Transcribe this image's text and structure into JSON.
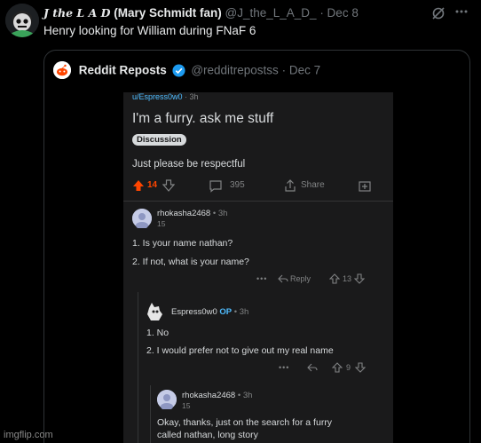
{
  "tweet": {
    "author_name_styled": "J the L A D",
    "author_name_suffix": "(Mary Schmidt fan)",
    "handle": "@J_the_L_A_D_",
    "date": "· Dec 8",
    "text": "Henry looking for William during FNaF 6",
    "icons": [
      "grok-icon",
      "more-icon"
    ]
  },
  "quote": {
    "author": "Reddit Reposts",
    "handle": "@redditrepostss",
    "date": "· Dec 7",
    "verified_color": "#1d9bf0"
  },
  "reddit_post": {
    "meta_user": "u/Espress0w0",
    "meta_time": "· 3h",
    "title": "I'm a furry. ask me stuff",
    "flair": "Discussion",
    "body": "Just please be respectful",
    "votes": "14",
    "comments": "395",
    "share_label": "Share",
    "upvote_color": "#ff4500"
  },
  "comments": [
    {
      "user": "rhokasha2468",
      "time": "• 3h",
      "sub": "15",
      "lines": [
        "1. Is your name nathan?",
        "2. If not, what is your name?"
      ],
      "reply_label": "Reply",
      "votes": "13"
    },
    {
      "user": "Espress0w0",
      "op_label": "OP",
      "time": "• 3h",
      "lines": [
        "1. No",
        "2. I would prefer not to give out my real name"
      ],
      "votes": "9"
    },
    {
      "user": "rhokasha2468",
      "time": "• 3h",
      "sub": "15",
      "lines": [
        "Okay, thanks, just on the search for a furry",
        "called nathan, long story"
      ]
    }
  ],
  "watermark": "imgflip.com"
}
